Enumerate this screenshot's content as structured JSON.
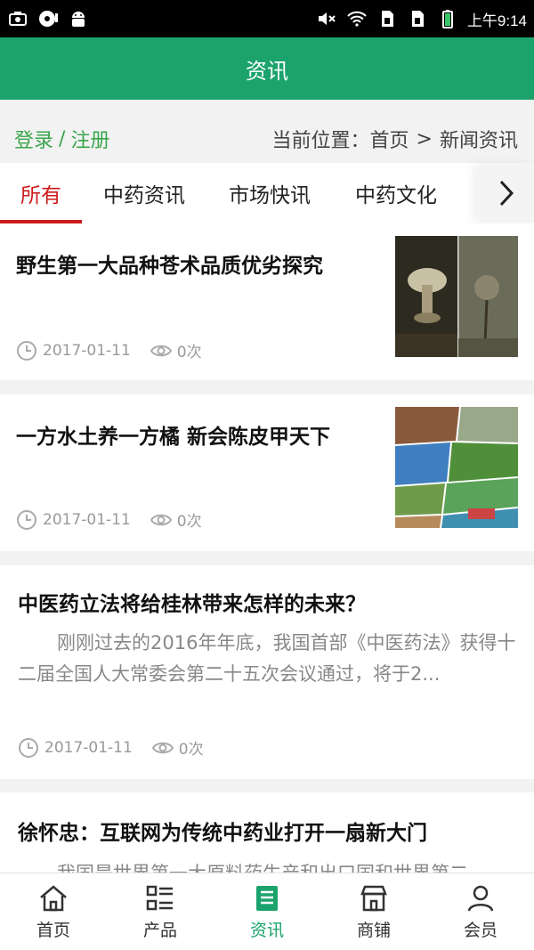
{
  "status_bar": {
    "time": "上午9:14",
    "left_icons": [
      "screenshot-icon",
      "media-icon",
      "android-icon"
    ],
    "right_icons": [
      "mute-icon",
      "wifi-icon",
      "sim1-icon",
      "sim2-icon",
      "battery-icon"
    ]
  },
  "header": {
    "title": "资讯"
  },
  "auth": {
    "login": "登录",
    "separator": "/",
    "register": "注册"
  },
  "breadcrumb": {
    "prefix": "当前位置：",
    "home": "首页",
    "separator": ">",
    "current": "新闻资讯"
  },
  "tabs": [
    {
      "label": "所有",
      "active": true
    },
    {
      "label": "中药资讯",
      "active": false
    },
    {
      "label": "市场快讯",
      "active": false
    },
    {
      "label": "中药文化",
      "active": false
    }
  ],
  "tabs_more_icon": "chevron-right-icon",
  "articles": [
    {
      "title": "野生第一大品种苍术品质优劣探究",
      "date": "2017-01-11",
      "views": "0次",
      "thumbnail": "mushroom-photo"
    },
    {
      "title": "一方水土养一方橘 新会陈皮甲天下",
      "date": "2017-01-11",
      "views": "0次",
      "thumbnail": "landscape-collage"
    },
    {
      "title": "中医药立法将给桂林带来怎样的未来？",
      "summary": "刚刚过去的2016年年底，我国首部《中医药法》获得十二届全国人大常委会第二十五次会议通过，将于2...",
      "date": "2017-01-11",
      "views": "0次"
    },
    {
      "title": "徐怀忠：互联网为传统中药业打开一扇新大门",
      "summary": "我国是世界第一大原料药生产和出口国和世界第二"
    }
  ],
  "bottom_nav": [
    {
      "label": "首页",
      "icon": "home-icon",
      "active": false
    },
    {
      "label": "产品",
      "icon": "list-icon",
      "active": false
    },
    {
      "label": "资讯",
      "icon": "news-icon",
      "active": true
    },
    {
      "label": "商铺",
      "icon": "shop-icon",
      "active": false
    },
    {
      "label": "会员",
      "icon": "user-icon",
      "active": false
    }
  ],
  "colors": {
    "brand_green": "#1ba36b",
    "tab_active_red": "#cc1b1b",
    "link_green": "#3aa64c"
  }
}
